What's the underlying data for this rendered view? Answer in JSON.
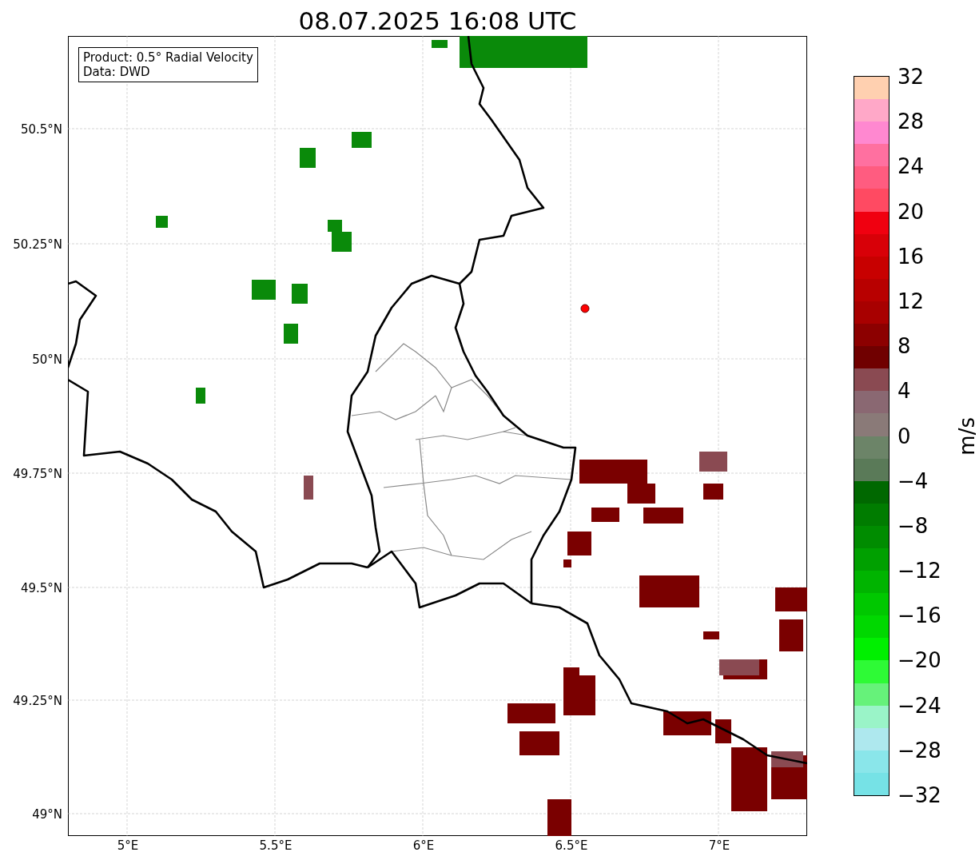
{
  "title": "08.07.2025 16:08 UTC",
  "map": {
    "info_box": [
      "Product: 0.5° Radial Velocity",
      "Data: DWD"
    ],
    "lat_labels": [
      "50.5°N",
      "50.25°N",
      "50°N",
      "49.75°N",
      "49.5°N",
      "49.25°N",
      "49°N"
    ],
    "lon_labels": [
      "5°E",
      "5.5°E",
      "6°E",
      "6.5°E",
      "7°E"
    ]
  },
  "colorbar": {
    "label": "m/s",
    "ticks": [
      "32",
      "28",
      "24",
      "20",
      "16",
      "12",
      "8",
      "4",
      "0",
      "−4",
      "−8",
      "−12",
      "−16",
      "−20",
      "−24",
      "−28",
      "−32"
    ],
    "segments": [
      {
        "color": "#ffd0b0"
      },
      {
        "color": "#ffa8c8"
      },
      {
        "color": "#ff88d0"
      },
      {
        "color": "#ff70a0"
      },
      {
        "color": "#ff5c80"
      },
      {
        "color": "#ff4a62"
      },
      {
        "color": "#f00010"
      },
      {
        "color": "#d80008"
      },
      {
        "color": "#c80000"
      },
      {
        "color": "#b80000"
      },
      {
        "color": "#a80000"
      },
      {
        "color": "#8c0000"
      },
      {
        "color": "#700000"
      },
      {
        "color": "#8a4a52"
      },
      {
        "color": "#8a6872"
      },
      {
        "color": "#8a7a78"
      },
      {
        "color": "#6c8468"
      },
      {
        "color": "#5a7a58"
      },
      {
        "color": "#006800"
      },
      {
        "color": "#007c00"
      },
      {
        "color": "#008c00"
      },
      {
        "color": "#00a000"
      },
      {
        "color": "#00b400"
      },
      {
        "color": "#00c800"
      },
      {
        "color": "#00d800"
      },
      {
        "color": "#00f000"
      },
      {
        "color": "#2efa36"
      },
      {
        "color": "#66f27a"
      },
      {
        "color": "#9af4c8"
      },
      {
        "color": "#aee8ee"
      },
      {
        "color": "#8ae6ea"
      },
      {
        "color": "#76e2e6"
      }
    ]
  }
}
